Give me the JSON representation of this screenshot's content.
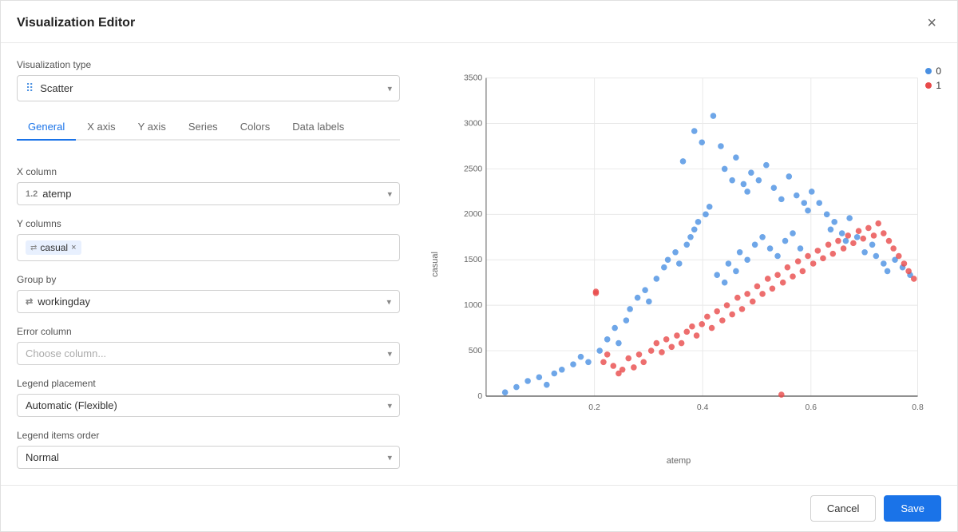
{
  "dialog": {
    "title": "Visualization Editor",
    "close_label": "×"
  },
  "vis_type": {
    "label": "Visualization type",
    "value": "Scatter",
    "icon": "⠿"
  },
  "tabs": [
    {
      "label": "General",
      "active": true
    },
    {
      "label": "X axis",
      "active": false
    },
    {
      "label": "Y axis",
      "active": false
    },
    {
      "label": "Series",
      "active": false
    },
    {
      "label": "Colors",
      "active": false
    },
    {
      "label": "Data labels",
      "active": false
    }
  ],
  "x_column": {
    "label": "X column",
    "icon": "1.2",
    "value": "atemp"
  },
  "y_columns": {
    "label": "Y columns",
    "tags": [
      {
        "icon": "⇄",
        "name": "casual"
      }
    ]
  },
  "group_by": {
    "label": "Group by",
    "icon": "⇄",
    "value": "workingday"
  },
  "error_column": {
    "label": "Error column",
    "placeholder": "Choose column..."
  },
  "legend_placement": {
    "label": "Legend placement",
    "value": "Automatic (Flexible)"
  },
  "legend_items_order": {
    "label": "Legend items order",
    "value": "Normal"
  },
  "chart": {
    "y_label": "casual",
    "x_label": "atemp",
    "y_ticks": [
      "0",
      "500",
      "1000",
      "1500",
      "2000",
      "2500",
      "3000",
      "3500"
    ],
    "x_ticks": [
      "0.2",
      "0.4",
      "0.6",
      "0.8"
    ],
    "legend": [
      {
        "label": "0",
        "color": "#4a90e2"
      },
      {
        "label": "1",
        "color": "#e84a4a"
      }
    ]
  },
  "footer": {
    "cancel_label": "Cancel",
    "save_label": "Save"
  }
}
